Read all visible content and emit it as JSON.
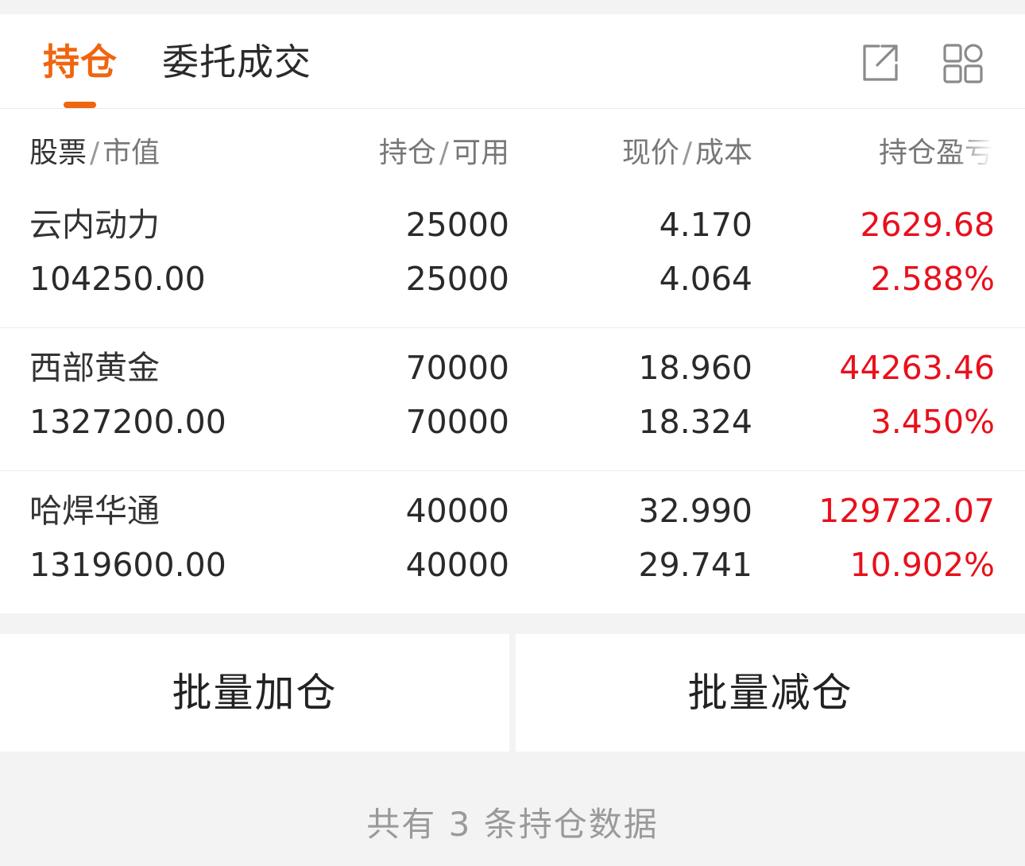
{
  "tabs": [
    {
      "label": "持仓",
      "active": true
    },
    {
      "label": "委托成交",
      "active": false
    }
  ],
  "header_icons": [
    "share-export-icon",
    "grid-apps-icon"
  ],
  "columns": {
    "stock": {
      "main": "股票",
      "sep": "/",
      "sub": "市值"
    },
    "position": {
      "main": "持仓",
      "sep": "/",
      "sub": "可用"
    },
    "price": {
      "main": "现价",
      "sep": "/",
      "sub": "成本"
    },
    "pl": {
      "main": "持仓盈亏"
    }
  },
  "holdings": [
    {
      "name": "云内动力",
      "market_value": "104250.00",
      "position": "25000",
      "available": "25000",
      "price": "4.170",
      "cost": "4.064",
      "pl": "2629.68",
      "pl_pct": "2.588%"
    },
    {
      "name": "西部黄金",
      "market_value": "1327200.00",
      "position": "70000",
      "available": "70000",
      "price": "18.960",
      "cost": "18.324",
      "pl": "44263.46",
      "pl_pct": "3.450%"
    },
    {
      "name": "哈焊华通",
      "market_value": "1319600.00",
      "position": "40000",
      "available": "40000",
      "price": "32.990",
      "cost": "29.741",
      "pl": "129722.07",
      "pl_pct": "10.902%"
    }
  ],
  "actions": {
    "batch_add": "批量加仓",
    "batch_reduce": "批量减仓"
  },
  "footer": "共有 3 条持仓数据",
  "colors": {
    "accent": "#f0650f",
    "profit": "#e8101c"
  }
}
